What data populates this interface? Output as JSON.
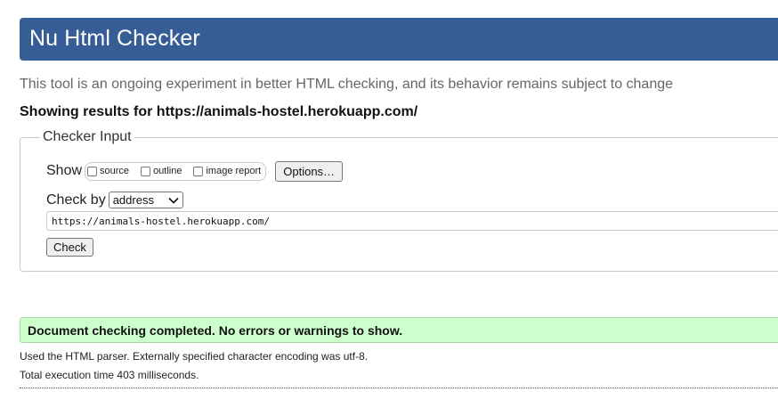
{
  "header": {
    "title": "Nu Html Checker",
    "color": "#365d95"
  },
  "intro_text": "This tool is an ongoing experiment in better HTML checking, and its behavior remains subject to change",
  "results_for": "Showing results for https://animals-hostel.herokuapp.com/",
  "checker_input": {
    "legend": "Checker Input",
    "show_label": "Show",
    "show_options": [
      {
        "label": "source",
        "checked": false
      },
      {
        "label": "outline",
        "checked": false
      },
      {
        "label": "image report",
        "checked": false
      }
    ],
    "options_button": "Options…",
    "check_by_label": "Check by",
    "check_by_selected": "address",
    "url_value": "https://animals-hostel.herokuapp.com/",
    "check_button": "Check"
  },
  "result": {
    "message": "Document checking completed. No errors or warnings to show.",
    "color": "#ccffcc"
  },
  "details": {
    "parser_line": "Used the HTML parser. Externally specified character encoding was utf-8.",
    "time_line": "Total execution time 403 milliseconds."
  }
}
